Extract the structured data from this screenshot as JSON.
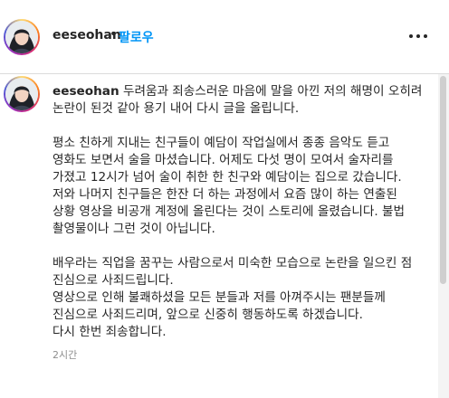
{
  "header": {
    "username": "eeseohan",
    "separator": "•",
    "follow_label": "팔로우",
    "more_icon": "more-horizontal-icon"
  },
  "post": {
    "username": "eeseohan",
    "caption": "두려움과 죄송스러운 마음에 말을 아낀 저의 해명이 오히려 논란이 된것 같아 용기 내어 다시 글을 올립니다.\n\n평소 친하게 지내는 친구들이 예담이 작업실에서 종종 음악도 듣고 영화도 보면서 술을 마셨습니다. 어제도 다섯 명이 모여서 술자리를 가졌고 12시가 넘어 술이 취한 한 친구와 예담이는 집으로 갔습니다.\n저와 나머지 친구들은 한잔 더 하는 과정에서 요즘 많이 하는 연출된 상황 영상을 비공개 계정에 올린다는 것이 스토리에 올렸습니다. 불법 촬영물이나 그런 것이 아닙니다.\n\n배우라는 직업을 꿈꾸는 사람으로서 미숙한 모습으로 논란을 일으킨 점 진심으로 사죄드립니다.\n영상으로 인해 불쾌하셨을 모든 분들과 저를 아껴주시는 팬분들께 진심으로 사죄드리며, 앞으로 신중히 행동하도록 하겠습니다.\n다시 한번 죄송합니다.",
    "time": "2시간"
  },
  "colors": {
    "accent": "#0095f6",
    "text": "#262626",
    "muted": "#8e8e8e",
    "border": "#dbdbdb"
  }
}
